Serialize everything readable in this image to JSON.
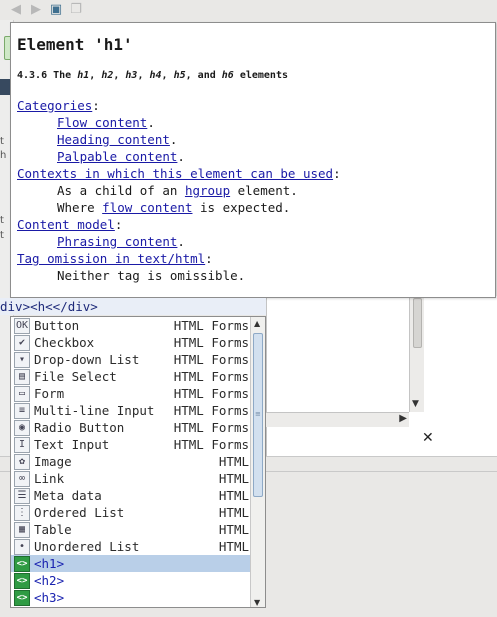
{
  "doc": {
    "element_title": "Element 'h1'",
    "section_heading": {
      "number": "4.3.6 The ",
      "tags": [
        "h1",
        "h2",
        "h3",
        "h4",
        "h5"
      ],
      "sep1": ", ",
      "and_text": ", and ",
      "last_tag": "h6",
      "suffix": " elements"
    },
    "categories_label": "Categories",
    "categories": [
      "Flow content",
      "Heading content",
      "Palpable content"
    ],
    "contexts_label": "Contexts in which this element can be used",
    "context_line1_prefix": "As a child of an ",
    "context_line1_link": "hgroup",
    "context_line1_suffix": " element.",
    "context_line2_prefix": "Where ",
    "context_line2_link": "flow content",
    "context_line2_suffix": " is expected.",
    "content_model_label": "Content model",
    "content_model_value": "Phrasing content",
    "tag_omission_label": "Tag omission in text/html",
    "tag_omission_value": "Neither tag is omissible."
  },
  "editor": {
    "line_text": "div><h<</div>"
  },
  "completion": {
    "items": [
      {
        "icon": "button-icon",
        "glyph": "OK",
        "name": "Button",
        "type": "HTML Forms"
      },
      {
        "icon": "checkbox-icon",
        "glyph": "✔",
        "name": "Checkbox",
        "type": "HTML Forms"
      },
      {
        "icon": "dropdown-icon",
        "glyph": "▾",
        "name": "Drop-down List",
        "type": "HTML Forms"
      },
      {
        "icon": "file-select-icon",
        "glyph": "▤",
        "name": "File Select",
        "type": "HTML Forms"
      },
      {
        "icon": "form-icon",
        "glyph": "▭",
        "name": "Form",
        "type": "HTML Forms"
      },
      {
        "icon": "multiline-input-icon",
        "glyph": "≡",
        "name": "Multi-line Input",
        "type": "HTML Forms"
      },
      {
        "icon": "radio-button-icon",
        "glyph": "◉",
        "name": "Radio Button",
        "type": "HTML Forms"
      },
      {
        "icon": "text-input-icon",
        "glyph": "I",
        "name": "Text Input",
        "type": "HTML Forms"
      },
      {
        "icon": "image-icon",
        "glyph": "✿",
        "name": "Image",
        "type": "HTML"
      },
      {
        "icon": "link-icon",
        "glyph": "∞",
        "name": "Link",
        "type": "HTML"
      },
      {
        "icon": "meta-data-icon",
        "glyph": "☰",
        "name": "Meta data",
        "type": "HTML"
      },
      {
        "icon": "ordered-list-icon",
        "glyph": "⋮",
        "name": "Ordered List",
        "type": "HTML"
      },
      {
        "icon": "table-icon",
        "glyph": "▦",
        "name": "Table",
        "type": "HTML"
      },
      {
        "icon": "unordered-list-icon",
        "glyph": "•",
        "name": "Unordered List",
        "type": "HTML"
      },
      {
        "icon": "tag-icon",
        "glyph": "<>",
        "name": "<h1>",
        "type": ""
      },
      {
        "icon": "tag-icon",
        "glyph": "<>",
        "name": "<h2>",
        "type": ""
      },
      {
        "icon": "tag-icon",
        "glyph": "<>",
        "name": "<h3>",
        "type": ""
      }
    ],
    "selected_index": 14
  },
  "colors": {
    "link": "#1a1aa6",
    "selection": "#b9cfe8",
    "tag_icon": "#2f9b43"
  }
}
